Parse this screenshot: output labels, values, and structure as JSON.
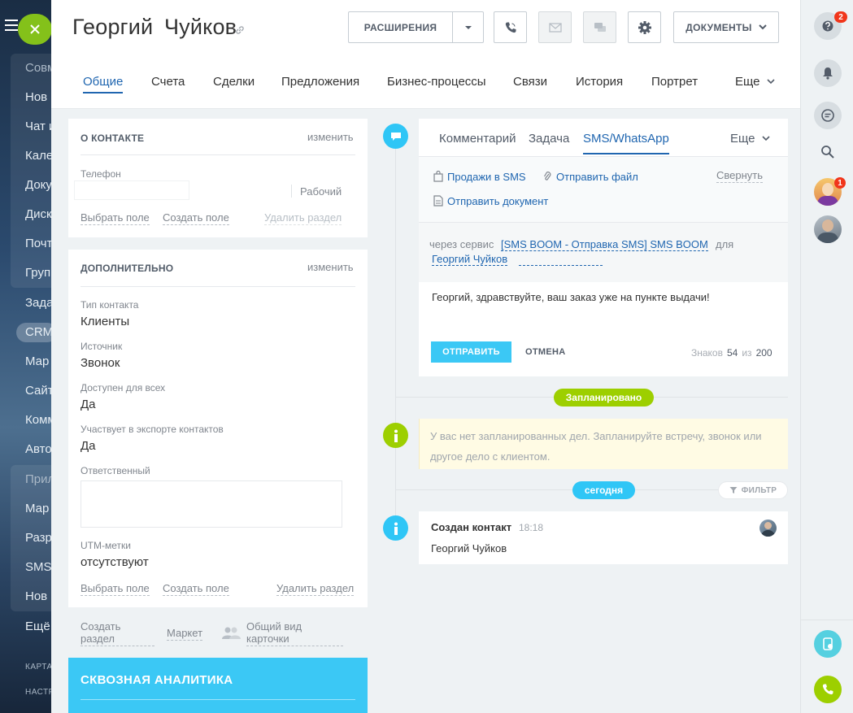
{
  "sidebar": {
    "items": [
      "Совм",
      "Нов",
      "Чат и",
      "Кале",
      "Доку",
      "Диск",
      "Почт",
      "Груп",
      "Зада",
      "CRM",
      "Мар",
      "Сайт",
      "Комм",
      "Авто",
      "Прил",
      "Мар",
      "Разр",
      "SMS",
      "Нов",
      "Ещё"
    ],
    "footer": [
      "КАРТА",
      "НАСТР"
    ]
  },
  "header": {
    "contact_name": "Георгий  Чуйков",
    "buttons": {
      "extensions": "РАСШИРЕНИЯ",
      "documents": "ДОКУМЕНТЫ"
    },
    "tabs": [
      "Общие",
      "Счета",
      "Сделки",
      "Предложения",
      "Бизнес-процессы",
      "Связи",
      "История",
      "Портрет",
      "Еще"
    ]
  },
  "about_contact": {
    "title": "О КОНТАКТЕ",
    "edit": "изменить",
    "phone_label": "Телефон",
    "phone_type": "Рабочий",
    "select_field": "Выбрать поле",
    "create_field": "Создать поле",
    "delete_section": "Удалить раздел"
  },
  "additional": {
    "title": "ДОПОЛНИТЕЛЬНО",
    "edit": "изменить",
    "fields": [
      {
        "label": "Тип контакта",
        "value": "Клиенты"
      },
      {
        "label": "Источник",
        "value": "Звонок"
      },
      {
        "label": "Доступен для всех",
        "value": "Да"
      },
      {
        "label": "Участвует в экспорте контактов",
        "value": "Да"
      }
    ],
    "responsible_label": "Ответственный",
    "utm_label": "UTM-метки",
    "utm_value": "отсутствуют",
    "select_field": "Выбрать поле",
    "create_field": "Создать поле",
    "delete_section": "Удалить раздел"
  },
  "bottom_links": {
    "create_section": "Создать раздел",
    "market": "Маркет",
    "general_view": "Общий вид карточки"
  },
  "analytics": {
    "title": "СКВОЗНАЯ АНАЛИТИКА"
  },
  "editor": {
    "tabs": [
      "Комментарий",
      "Задача",
      "SMS/WhatsApp",
      "Еще"
    ],
    "active_tab": "SMS/WhatsApp",
    "actions": {
      "sales_sms": "Продажи в SMS",
      "send_file": "Отправить файл",
      "collapse": "Свернуть",
      "send_document": "Отправить документ"
    },
    "via_service": "через сервис",
    "service_name": "[SMS BOOM - Отправка SMS] SMS BOOM",
    "for": "для",
    "recipient": "Георгий Чуйков",
    "message": "Георгий, здравствуйте, ваш заказ уже на пункте выдачи!",
    "send": "ОТПРАВИТЬ",
    "cancel": "ОТМЕНА",
    "chars_label": "Знаков",
    "chars_count": "54",
    "chars_of": "из",
    "chars_max": "200"
  },
  "timeline": {
    "planned": "Запланировано",
    "planned_text": "У вас нет запланированных дел. Запланируйте встречу, звонок или другое дело с клиентом.",
    "today": "сегодня",
    "filter": "ФИЛЬТР",
    "event_title": "Создан контакт",
    "event_time": "18:18",
    "event_body": "Георгий Чуйков"
  },
  "right_panel": {
    "help_badge": "2",
    "avatar_badge": "1"
  },
  "colors": {
    "accent_blue": "#2066b0",
    "green": "#9dcf00",
    "cyan": "#2fc6f6",
    "analytics_bg": "#3bc8f5"
  }
}
